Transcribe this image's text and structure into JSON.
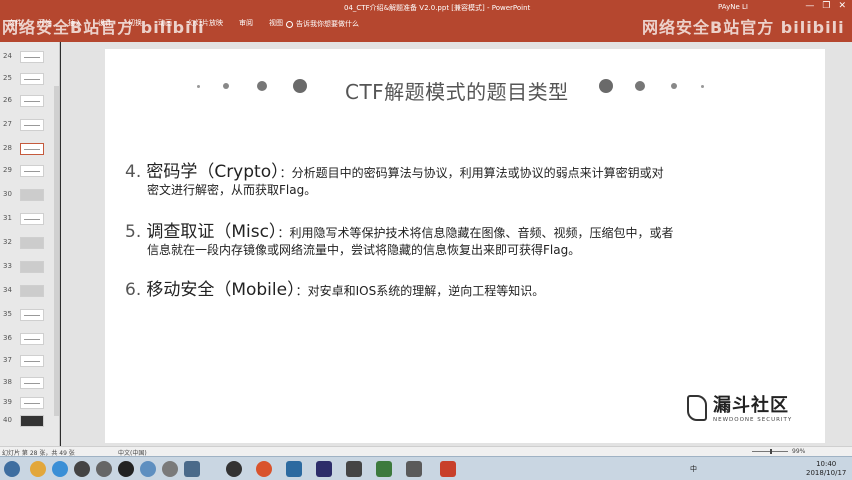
{
  "window": {
    "doc_title": "04_CTF介绍&解题准备 V2.0.ppt [兼容模式] - PowerPoint",
    "user": "PAyNe LI",
    "minimize": "—",
    "restore": "❐",
    "close": "✕"
  },
  "ribbon": {
    "tabs": [
      "文件",
      "开始",
      "插入",
      "设计",
      "切换",
      "动画",
      "幻灯片放映",
      "审阅",
      "视图"
    ],
    "tell_me": "告诉我你想要做什么"
  },
  "watermarks": {
    "left": "网络安全B站官方 bilibili",
    "right": "网络安全B站官方 bilibili"
  },
  "thumbnails": [
    {
      "num": "24"
    },
    {
      "num": "25"
    },
    {
      "num": "26"
    },
    {
      "num": "27"
    },
    {
      "num": "28"
    },
    {
      "num": "29"
    },
    {
      "num": "30"
    },
    {
      "num": "31"
    },
    {
      "num": "32"
    },
    {
      "num": "33"
    },
    {
      "num": "34"
    },
    {
      "num": "35"
    },
    {
      "num": "36"
    },
    {
      "num": "37"
    },
    {
      "num": "38"
    },
    {
      "num": "39"
    },
    {
      "num": "40"
    }
  ],
  "slide": {
    "title": "CTF解题模式的题目类型",
    "items": [
      {
        "num": "4.",
        "head": "密码学（Crypto）",
        "desc1": "：分析题目中的密码算法与协议，利用算法或协议的弱点来计算密钥或对",
        "desc2": "密文进行解密，从而获取Flag。"
      },
      {
        "num": "5.",
        "head": "调查取证（Misc）",
        "desc1": "：利用隐写术等保护技术将信息隐藏在图像、音频、视频，压缩包中，或者",
        "desc2": "信息就在一段内存镜像或网络流量中，尝试将隐藏的信息恢复出来即可获得Flag。"
      },
      {
        "num": "6.",
        "head": "移动安全（Mobile）",
        "desc1": "：对安卓和IOS系统的理解，逆向工程等知识。",
        "desc2": ""
      }
    ],
    "logo_cn": "漏斗社区",
    "logo_en": "NEWDOONE SECURITY"
  },
  "statusbar": {
    "slide_info": "幻灯片 第 28 张，共 49 张",
    "language": "中文(中国)",
    "zoom": "99%"
  },
  "taskbar": {
    "time": "10:40",
    "date": "2018/10/17",
    "tray_lang": "中"
  }
}
